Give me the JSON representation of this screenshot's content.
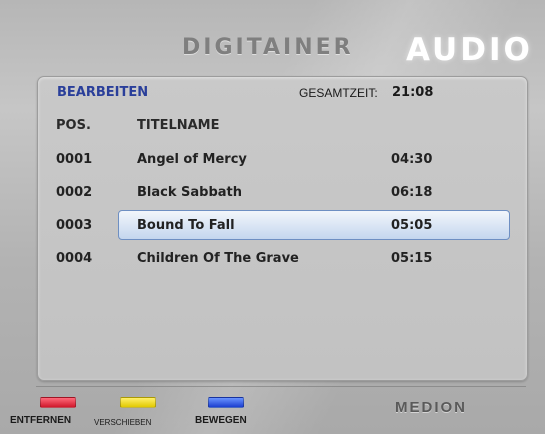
{
  "header": {
    "brand": "DIGITAINER",
    "section": "AUDIO"
  },
  "panel": {
    "mode_label": "BEARBEITEN",
    "total_time_label": "GESAMTZEIT:",
    "total_time_value": "21:08",
    "columns": {
      "pos": "POS.",
      "title": "TITELNAME"
    },
    "tracks": [
      {
        "pos": "0001",
        "title": "Angel of Mercy",
        "time": "04:30",
        "selected": false
      },
      {
        "pos": "0002",
        "title": "Black Sabbath",
        "time": "06:18",
        "selected": false
      },
      {
        "pos": "0003",
        "title": "Bound To Fall",
        "time": "05:05",
        "selected": true
      },
      {
        "pos": "0004",
        "title": "Children Of The Grave",
        "time": "05:15",
        "selected": false
      }
    ]
  },
  "footer": {
    "red_label": "ENTFERNEN",
    "yellow_label": "VERSCHIEBEN",
    "blue_label": "BEWEGEN",
    "logo": "MEDION"
  },
  "colors": {
    "mode_label": "#2a3f9a",
    "selection": "#c4d6ee",
    "red_key": "#d0182c",
    "yellow_key": "#e1c900",
    "blue_key": "#1c3fd0"
  }
}
